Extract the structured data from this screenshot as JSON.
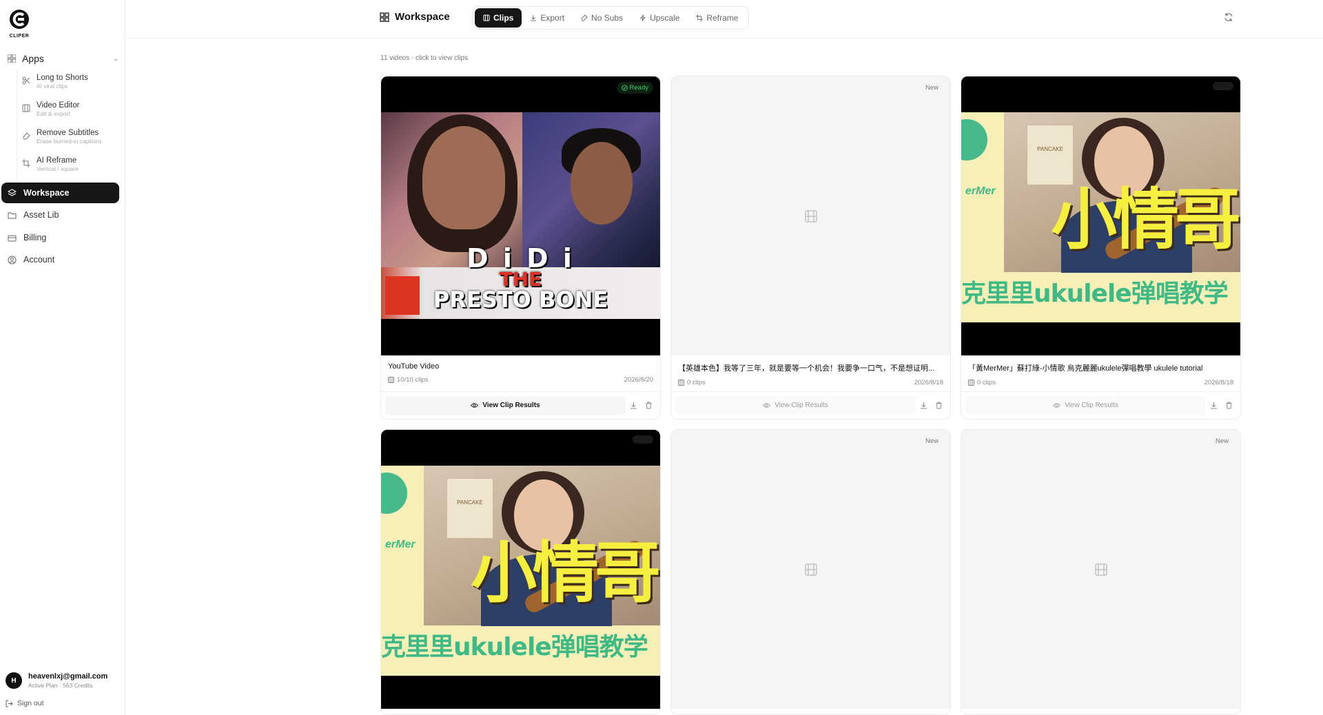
{
  "app": {
    "logo_text": "CLIPER"
  },
  "sidebar": {
    "apps_label": "Apps",
    "apps_items": [
      {
        "title": "Long to Shorts",
        "subtitle": "AI viral clips",
        "icon": "scissors-icon"
      },
      {
        "title": "Video Editor",
        "subtitle": "Edit & export",
        "icon": "film-icon"
      },
      {
        "title": "Remove Subtitles",
        "subtitle": "Erase burned-in captions",
        "icon": "eraser-icon"
      },
      {
        "title": "AI Reframe",
        "subtitle": "Vertical / square",
        "icon": "crop-icon"
      }
    ],
    "nav": [
      {
        "label": "Workspace",
        "icon": "layers-icon",
        "active": true
      },
      {
        "label": "Asset Lib",
        "icon": "folder-icon",
        "active": false
      },
      {
        "label": "Billing",
        "icon": "card-icon",
        "active": false
      },
      {
        "label": "Account",
        "icon": "user-circle-icon",
        "active": false
      }
    ],
    "user": {
      "initial": "H",
      "email": "heavenlxj@gmail.com",
      "plan": "Active Plan · 563 Credits"
    },
    "signout": "Sign out"
  },
  "header": {
    "title": "Workspace",
    "tabs": [
      {
        "label": "Clips",
        "active": true
      },
      {
        "label": "Export",
        "active": false
      },
      {
        "label": "No Subs",
        "active": false
      },
      {
        "label": "Upscale",
        "active": false
      },
      {
        "label": "Reframe",
        "active": false
      }
    ]
  },
  "main": {
    "summary": "11 videos · click to view clips",
    "cards": [
      {
        "name": "YouTube Video",
        "clips": "10/10 clips",
        "date": "2026/8/20",
        "badge": "Ready",
        "button": "View Clip Results",
        "thumb": "didi"
      },
      {
        "name": "【英雄本色】我等了三年，就是要等一个机会！我要争一口气，不是想证明...",
        "clips": "0 clips",
        "date": "2026/8/18",
        "badge": "New",
        "button": "View Clip Results",
        "thumb": "empty"
      },
      {
        "name": "「黃MerMer」蘇打綠-小情歌 烏克麗麗ukulele彈唱教學 ukulele tutorial",
        "clips": "0 clips",
        "date": "2026/8/18",
        "badge": "",
        "button": "View Clip Results",
        "thumb": "mermer"
      },
      {
        "thumb": "mermer",
        "badge": ""
      },
      {
        "thumb": "empty",
        "badge": "New"
      },
      {
        "thumb": "empty",
        "badge": "New"
      }
    ],
    "thumb_text": {
      "didi_line1": "D i D i",
      "didi_line2": "THE",
      "didi_line3": "PRESTO BONE",
      "mm_big": "小情哥",
      "mm_band": "克里里ukulele弹唱教学",
      "mm_side": "erMer",
      "mm_sign": "PANCAKE"
    }
  },
  "colors": {
    "accent": "#161616",
    "ready": "#3bd16b"
  }
}
